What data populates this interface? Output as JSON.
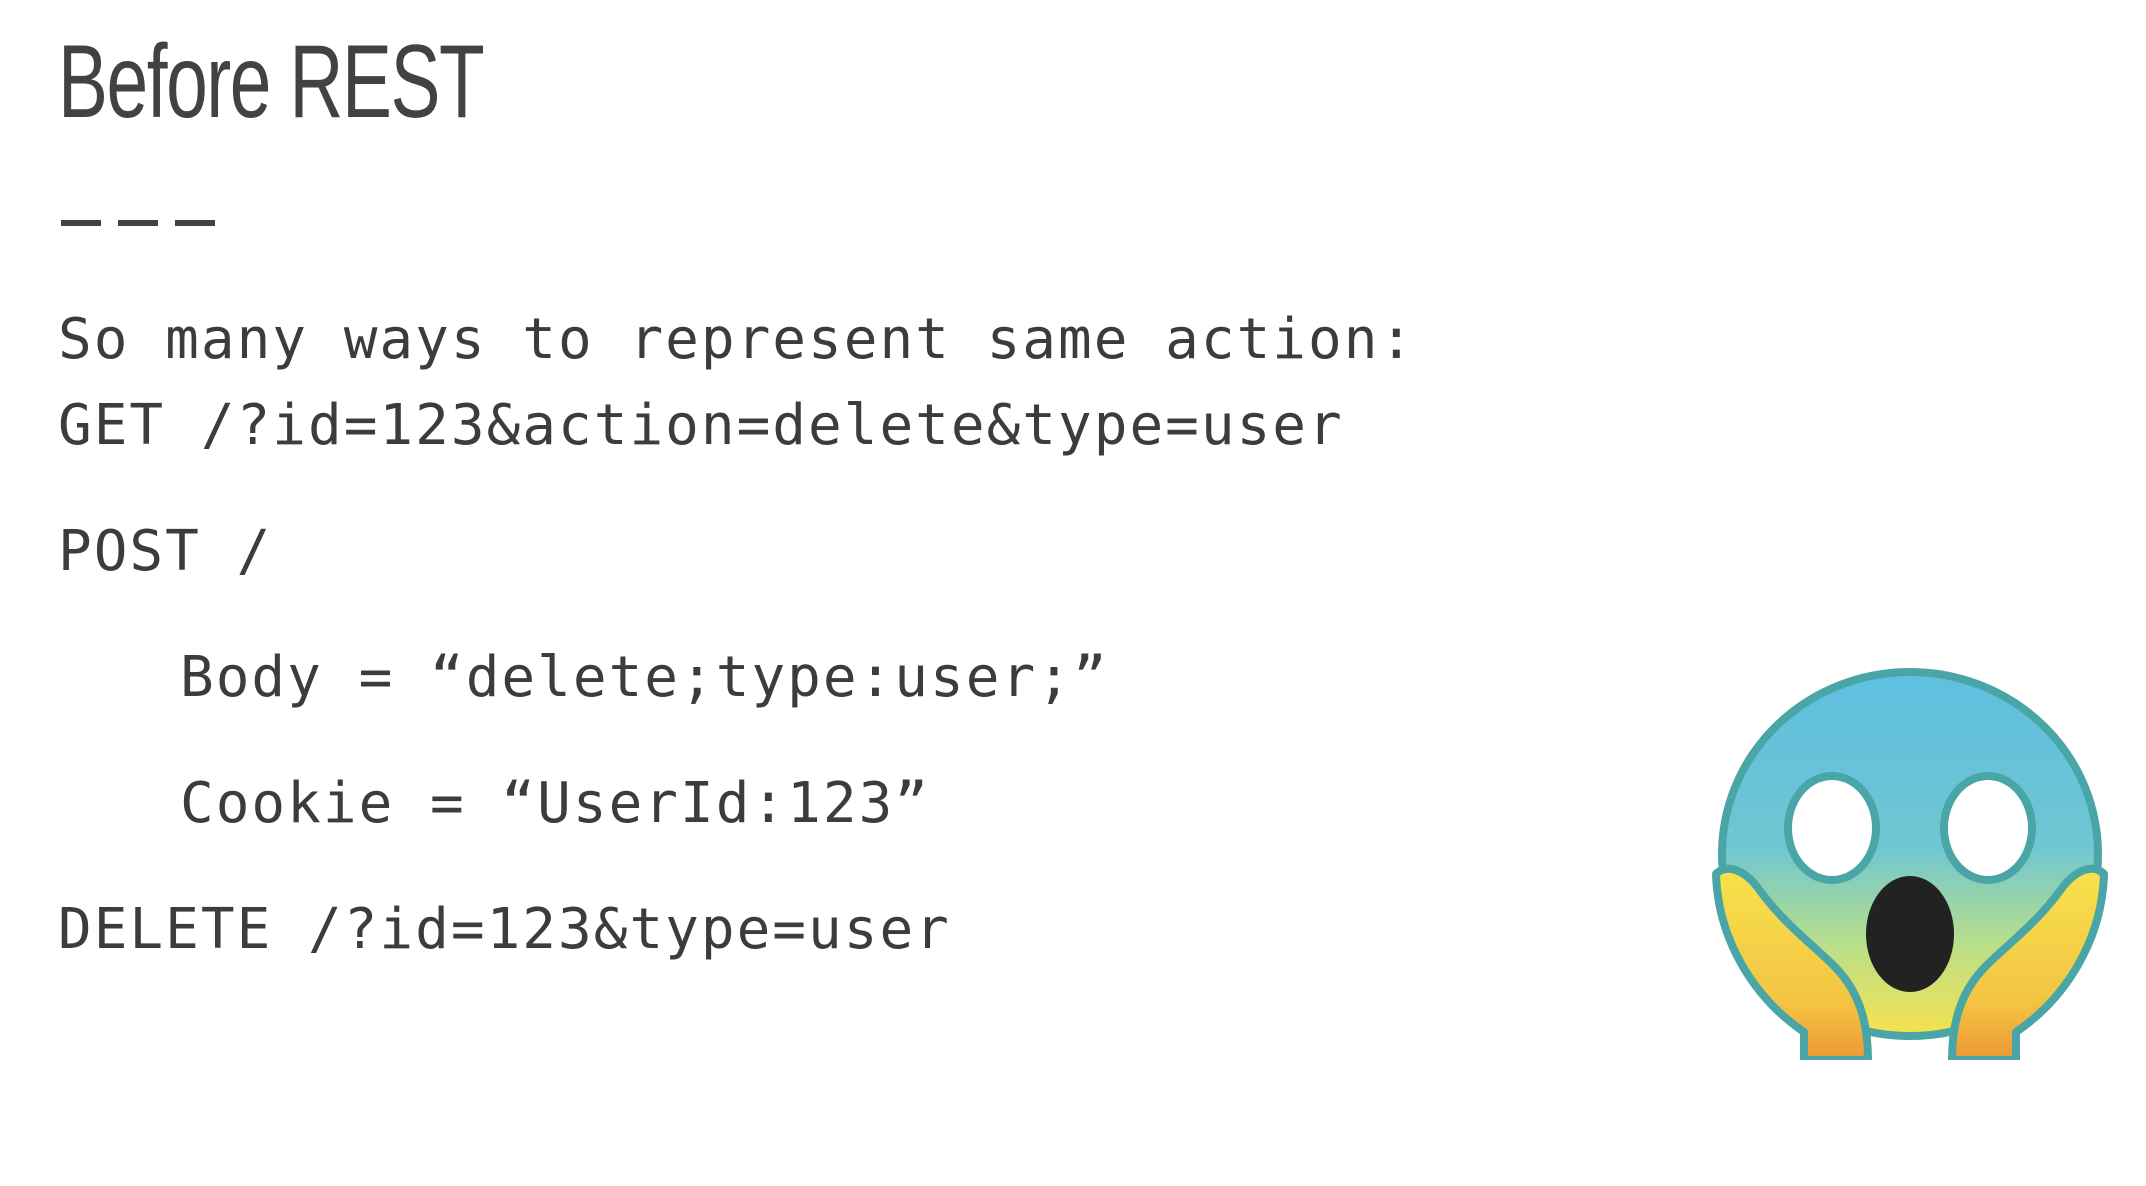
{
  "slide": {
    "title": "Before REST",
    "lines": [
      "So many ways to represent same action:",
      "GET /?id=123&action=delete&type=user",
      "POST /",
      "Body = “delete;type:user;”",
      "Cookie = “UserId:123”",
      "DELETE /?id=123&type=user"
    ],
    "emoji_icon": "face-screaming-in-fear-icon"
  },
  "colors": {
    "text": "#424242",
    "face_top": "#5FBFE0",
    "face_bottom": "#F6E24C",
    "hands": "#F2A33A",
    "outline": "#4AA6A6",
    "mouth": "#222222"
  }
}
